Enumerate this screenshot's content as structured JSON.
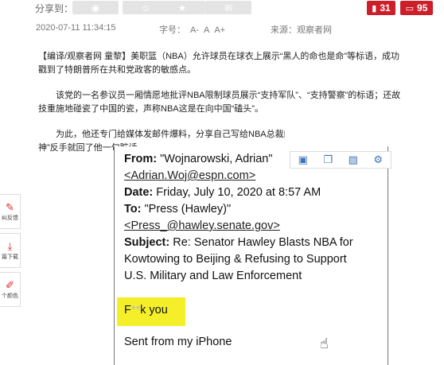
{
  "share": {
    "label": "分享到：",
    "buttons": [
      {
        "name": "weibo-icon",
        "glyph": "◉"
      },
      {
        "name": "qq-icon",
        "glyph": "☺"
      },
      {
        "name": "favorite-icon",
        "glyph": "★"
      },
      {
        "name": "wechat-icon",
        "glyph": "✉"
      }
    ],
    "bookmark_count": "31",
    "comment_count": "95"
  },
  "meta": {
    "datetime": "2020-07-11 11:34:15",
    "font_size_label": "字号：",
    "font_sizes": [
      "A-",
      "A",
      "A+"
    ],
    "source": "来源：观察者网"
  },
  "article": {
    "paragraphs": [
      [
        "【编译/观察者网 童黎】美职篮（NBA）允许球员在球衣上展示“黑人的命也是命”等标语，成功",
        "戳到了特朗普所在共和党政客的敏感点。"
      ],
      [
        "　　该党的一名参议员一厢情愿地批评NBA限制球员展示“支持军队”、“支持警察”的标语；还故",
        "技重施地碰瓷了中国的瓷，声称NBA这是在向中国“磕头”。"
      ],
      [
        "　　为此，他还专门给媒体发邮件爆料，分享自己写给NBA总裁的公开信。不料，著名NBA记者“沃",
        "神”反手就回了他一句脏话。"
      ]
    ]
  },
  "sidebar": {
    "items": [
      {
        "label": "纠反馈",
        "glyph": "✎"
      },
      {
        "label": "篇下载",
        "glyph": "⤓"
      },
      {
        "label": "个颜色",
        "glyph": "✐"
      }
    ]
  },
  "image_toolbar": {
    "icons": [
      "save-icon",
      "copy-icon",
      "image-search-icon",
      "settings-icon"
    ],
    "glyphs": [
      "▣",
      "❐",
      "▨",
      "⚙"
    ]
  },
  "email": {
    "from_label": "From:",
    "from_value": "\"Wojnarowski, Adrian\"",
    "from_email": "<Adrian.Woj@espn.com>",
    "date_label": "Date:",
    "date_value": "Friday, July 10, 2020 at 8:57 AM",
    "to_label": "To:",
    "to_value": "\"Press (Hawley)\"",
    "to_email": "<Press_@hawley.senate.gov>",
    "subject_label": "Subject:",
    "subject_line1": "Re: Senator Hawley Blasts NBA for",
    "subject_line2": "Kowtowing to Beijing & Refusing to Support",
    "subject_line3": "U.S. Military and Law Enforcement",
    "reply_first": "F",
    "reply_blurred": "**",
    "reply_rest": "k you",
    "signature": "Sent from my iPhone",
    "highlight_color": "#f5ef2a"
  },
  "colors": {
    "accent_red": "#cc1f2a",
    "toolbar_blue": "#3f73b8"
  }
}
